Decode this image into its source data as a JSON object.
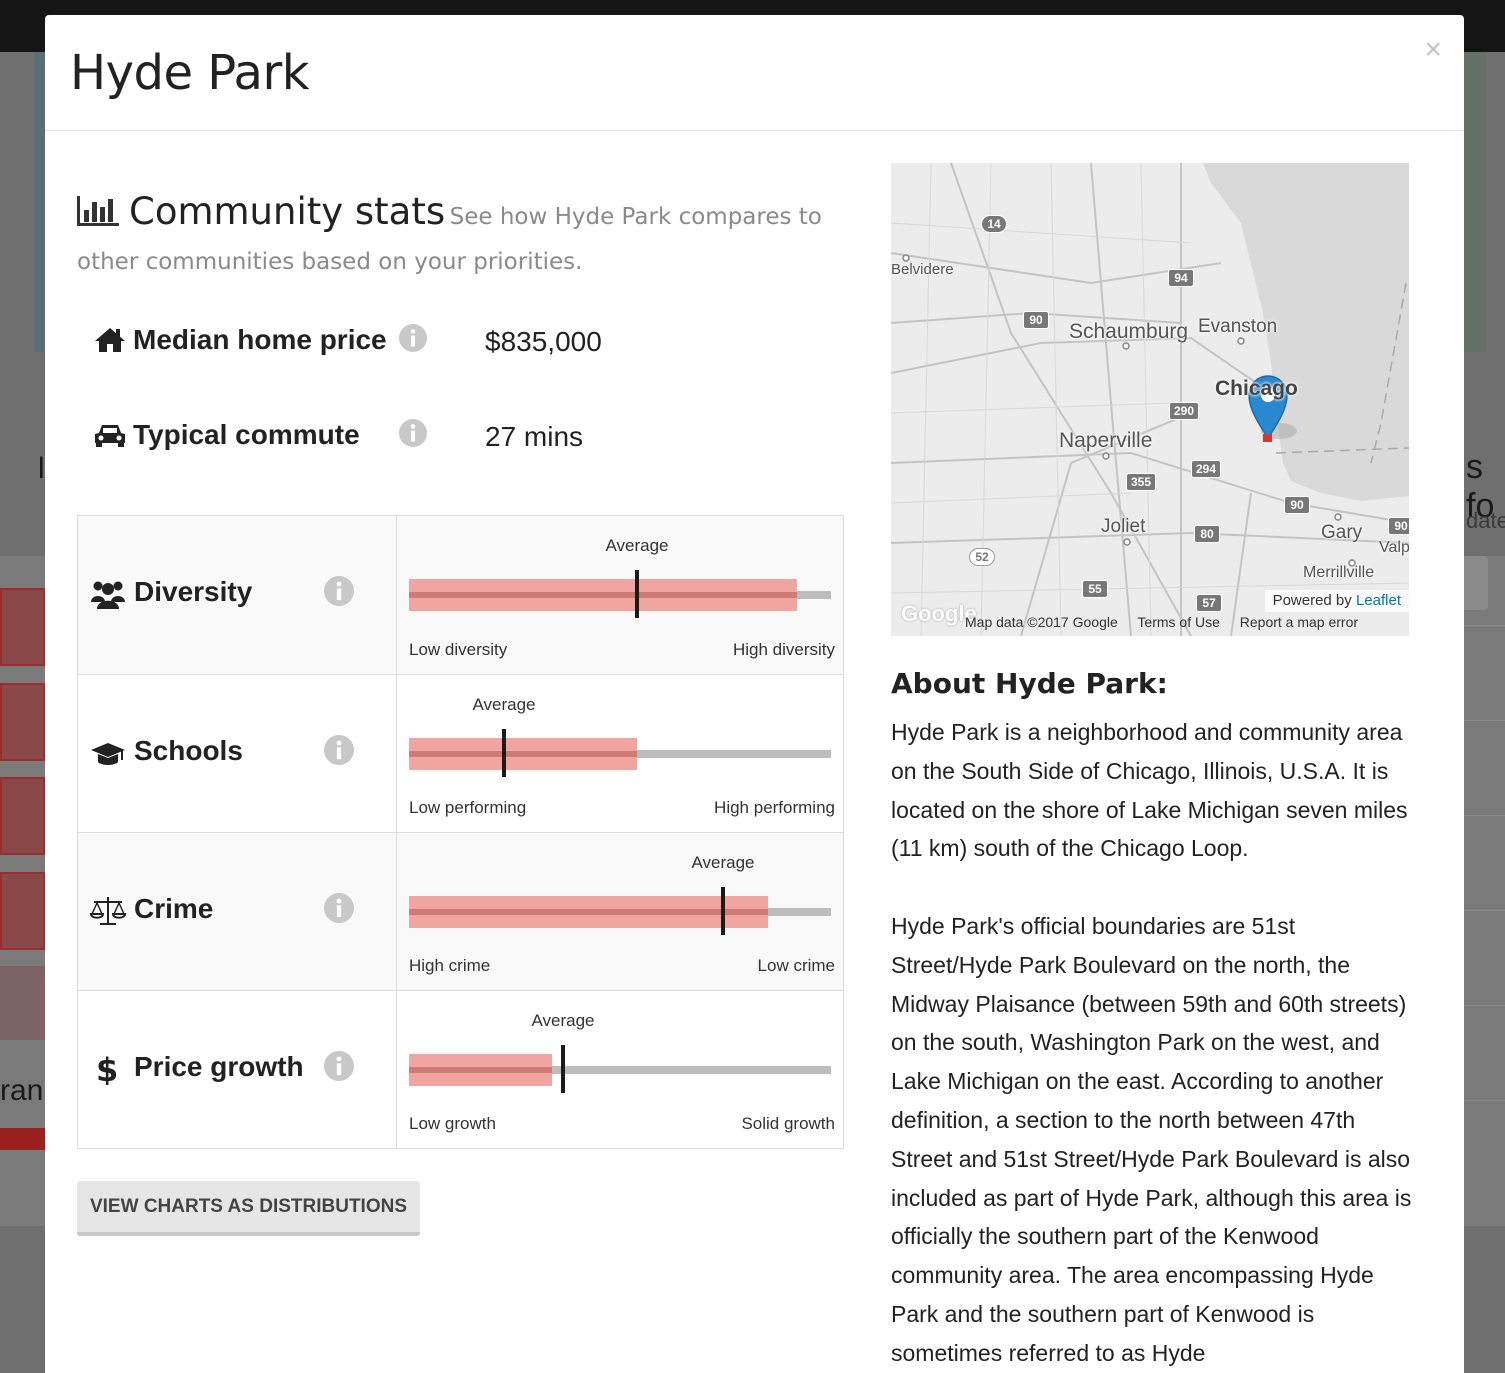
{
  "modal": {
    "title": "Hyde Park",
    "close_label": "×"
  },
  "stats": {
    "title": "Community stats",
    "subtitle": "See how Hyde Park compares to other communities based on your priorities.",
    "median_home_price": {
      "label": "Median home price",
      "value": "$835,000",
      "icon": "home-icon"
    },
    "typical_commute": {
      "label": "Typical commute",
      "value": "27 mins",
      "icon": "car-icon"
    }
  },
  "rows": [
    {
      "name": "Diversity",
      "icon": "users-icon",
      "avg_label": "Average",
      "low": "Low diversity",
      "high": "High diversity",
      "score": 0.92,
      "average": 0.54
    },
    {
      "name": "Schools",
      "icon": "graduation-cap-icon",
      "avg_label": "Average",
      "low": "Low performing",
      "high": "High performing",
      "score": 0.54,
      "average": 0.225
    },
    {
      "name": "Crime",
      "icon": "balance-scale-icon",
      "avg_label": "Average",
      "low": "High crime",
      "high": "Low crime",
      "score": 0.85,
      "average": 0.745
    },
    {
      "name": "Price growth",
      "icon": "dollar-icon",
      "avg_label": "Average",
      "low": "Low growth",
      "high": "Solid growth",
      "score": 0.34,
      "average": 0.365
    }
  ],
  "buttons": {
    "distributions": "VIEW CHARTS AS DISTRIBUTIONS"
  },
  "map": {
    "cities": [
      "Belvidere",
      "Schaumburg",
      "Evanston",
      "Chicago",
      "Naperville",
      "Joliet",
      "Gary",
      "Valp",
      "Merrillville"
    ],
    "shields": [
      "14",
      "94",
      "90",
      "290",
      "294",
      "355",
      "90",
      "80",
      "52",
      "55",
      "57",
      "90"
    ],
    "powered_by": "Powered by",
    "leaflet": "Leaflet",
    "map_data": "Map data ©2017 Google",
    "terms": "Terms of Use",
    "report": "Report a map error",
    "google": "Google",
    "water_color": "#d9d9d9",
    "marker_color": "#2a88d0"
  },
  "about": {
    "title": "About Hyde Park:",
    "paragraphs": [
      "Hyde Park is a neighborhood and community area on the South Side of Chicago, Illinois, U.S.A. It is located on the shore of Lake Michigan seven miles (11 km) south of the Chicago Loop.",
      "Hyde Park's official boundaries are 51st Street/Hyde Park Boulevard on the north, the Midway Plaisance (between 59th and 60th streets) on the south, Washington Park on the west, and Lake Michigan on the east. According to another definition, a section to the north between 47th Street and 51st Street/Hyde Park Boulevard is also included as part of Hyde Park, although this area is officially the southern part of the Kenwood community area. The area encompassing Hyde Park and the southern part of Kenwood is sometimes referred to as Hyde"
    ]
  },
  "background": {
    "fragment_left": "ran",
    "fragment_right_big": "s fo",
    "fragment_right_small": "date",
    "fragment_right_btn": "s",
    "fragment_left_top": "l"
  },
  "colors": {
    "fill": "#f0a5a0",
    "fill_line": "#d07a76",
    "track": "#bdbdbd",
    "marker": "#1b1b1b"
  }
}
